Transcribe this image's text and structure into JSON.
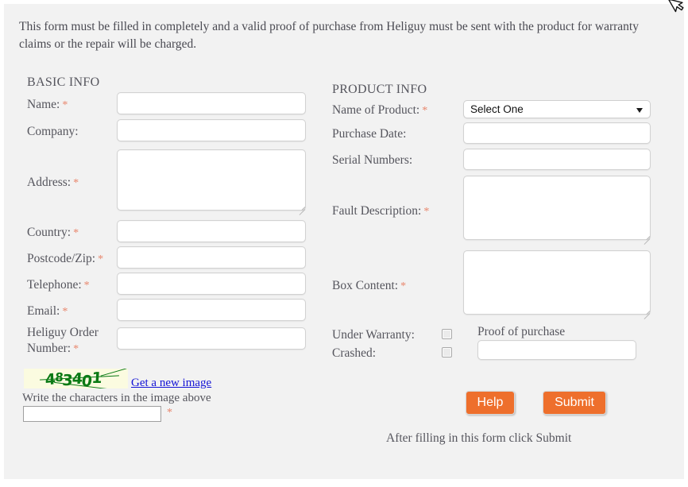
{
  "intro": {
    "text": "This form must be filled in completely and a valid proof of purchase from Heliguy must be sent with the product for warranty claims or the repair will be charged."
  },
  "basic_info": {
    "heading": "BASIC INFO",
    "fields": [
      {
        "label": "Name:",
        "required": "*",
        "value": "",
        "placeholder": ""
      },
      {
        "label": "Company:",
        "required": "",
        "value": "",
        "placeholder": ""
      },
      {
        "label": "Address:",
        "required": "*",
        "value": "",
        "placeholder": ""
      },
      {
        "label": "Country:",
        "required": "*",
        "value": "",
        "placeholder": ""
      },
      {
        "label": "Postcode/Zip:",
        "required": "*",
        "value": "",
        "placeholder": ""
      },
      {
        "label": "Telephone:",
        "required": "*",
        "value": "",
        "placeholder": ""
      },
      {
        "label": "Email:",
        "required": "*",
        "value": "",
        "placeholder": ""
      },
      {
        "label_line1": "Heliguy Order",
        "label_line2": "Number:",
        "required": "*",
        "value": "",
        "placeholder": ""
      }
    ]
  },
  "product_info": {
    "heading": "PRODUCT INFO",
    "name_of_product": {
      "label": "Name of Product:",
      "required": "*",
      "selected_option": "Select One"
    },
    "purchase_date": {
      "label": "Purchase Date:",
      "required": "",
      "value": "",
      "placeholder": ""
    },
    "serial_numbers": {
      "label": "Serial Numbers:",
      "required": "",
      "value": "",
      "placeholder": ""
    },
    "fault_description": {
      "label": "Fault Description:",
      "required": "*",
      "value": "",
      "placeholder": ""
    },
    "box_content": {
      "label": "Box Content:",
      "required": "*",
      "value": "",
      "placeholder": ""
    },
    "under_warranty": {
      "label": "Under Warranty:",
      "checked": false
    },
    "crashed": {
      "label": "Crashed:",
      "checked": false
    },
    "proof_of_purchase": {
      "label": "Proof of purchase",
      "value": "",
      "placeholder": ""
    }
  },
  "captcha": {
    "image_text": "483401",
    "chars": [
      "4",
      "8",
      "3",
      "4",
      "0",
      "1"
    ],
    "new_image_link": "Get a new image",
    "hint": "Write the characters in the image above",
    "input_value": "",
    "required": "*"
  },
  "actions": {
    "help_label": "Help",
    "submit_label": "Submit",
    "footer_note": "After filling in this form click Submit"
  },
  "colors": {
    "panel_bg": "#f2f2f2",
    "page_bg": "#ffffff",
    "text": "#55555d",
    "required_asterisk": "#e8856b",
    "button_orange": "#ee6f2c",
    "link_blue": "#1414d6",
    "captcha_green": "#0a7a15",
    "captcha_bg": "#fbfbe0"
  },
  "icons": {
    "select_arrow": "chevron-down-icon",
    "resize_handle": "resize-grip-icon",
    "cursor": "mouse-cursor-icon"
  }
}
